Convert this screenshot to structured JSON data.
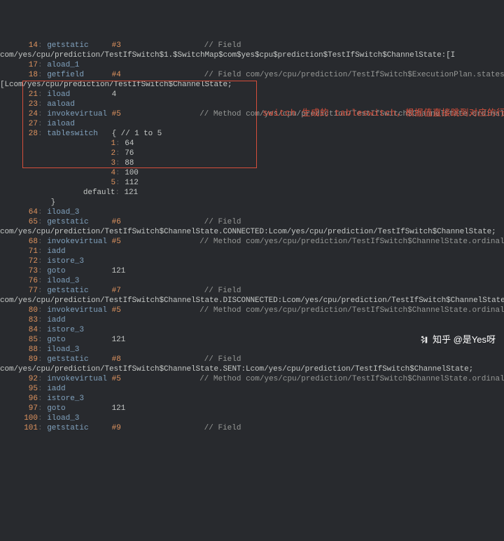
{
  "annotation": "switch 生成的 tableswitch，根据值直接跳到对应的行执行",
  "watermark": "知乎 @是Yes呀",
  "code": [
    {
      "ln": "14",
      "op": "getstatic",
      "arg": "#3",
      "comment": "// Field",
      "type": "a"
    },
    {
      "raw": "com/yes/cpu/prediction/TestIfSwitch$1.$SwitchMap$com$yes$cpu$prediction$TestIfSwitch$ChannelState:[I"
    },
    {
      "ln": "17",
      "op": "aload_1",
      "type": "b"
    },
    {
      "ln": "18",
      "op": "getfield",
      "arg": "#4",
      "comment": "// Field com/yes/cpu/prediction/TestIfSwitch$ExecutionPlan.states:",
      "type": "a"
    },
    {
      "raw": "[Lcom/yes/cpu/prediction/TestIfSwitch$ChannelState;"
    },
    {
      "ln": "21",
      "op": "iload",
      "argn": "4",
      "type": "c"
    },
    {
      "ln": "23",
      "op": "aaload",
      "type": "b"
    },
    {
      "ln": "24",
      "op": "invokevirtual",
      "arg2": "#5",
      "comment": "// Method com/yes/cpu/prediction/TestIfSwitch$ChannelState.ordinal:()I",
      "type": "d"
    },
    {
      "ln": "27",
      "op": "iaload",
      "type": "b"
    },
    {
      "ln": "28",
      "op": "tableswitch",
      "tail": "{ // 1 to 5",
      "type": "e"
    },
    {
      "sw": "1",
      "sv": "64"
    },
    {
      "sw": "2",
      "sv": "76"
    },
    {
      "sw": "3",
      "sv": "88"
    },
    {
      "sw": "4",
      "sv": "100"
    },
    {
      "sw": "5",
      "sv": "112"
    },
    {
      "swd": "default",
      "sv": "121"
    },
    {
      "braceclose": "}"
    },
    {
      "ln": "64",
      "op": "iload_3",
      "type": "b"
    },
    {
      "ln": "65",
      "op": "getstatic",
      "arg": "#6",
      "comment": "// Field",
      "type": "a"
    },
    {
      "raw": "com/yes/cpu/prediction/TestIfSwitch$ChannelState.CONNECTED:Lcom/yes/cpu/prediction/TestIfSwitch$ChannelState;"
    },
    {
      "ln": "68",
      "op": "invokevirtual",
      "arg2": "#5",
      "comment": "// Method com/yes/cpu/prediction/TestIfSwitch$ChannelState.ordinal:()I",
      "type": "d"
    },
    {
      "ln": "71",
      "op": "iadd",
      "type": "b"
    },
    {
      "ln": "72",
      "op": "istore_3",
      "type": "b"
    },
    {
      "ln": "73",
      "op": "goto",
      "argn": "121",
      "type": "c"
    },
    {
      "ln": "76",
      "op": "iload_3",
      "type": "b"
    },
    {
      "ln": "77",
      "op": "getstatic",
      "arg": "#7",
      "comment": "// Field",
      "type": "a"
    },
    {
      "raw": "com/yes/cpu/prediction/TestIfSwitch$ChannelState.DISCONNECTED:Lcom/yes/cpu/prediction/TestIfSwitch$ChannelState;"
    },
    {
      "ln": "80",
      "op": "invokevirtual",
      "arg2": "#5",
      "comment": "// Method com/yes/cpu/prediction/TestIfSwitch$ChannelState.ordinal:()I",
      "type": "d"
    },
    {
      "ln": "83",
      "op": "iadd",
      "type": "b"
    },
    {
      "ln": "84",
      "op": "istore_3",
      "type": "b"
    },
    {
      "ln": "85",
      "op": "goto",
      "argn": "121",
      "type": "c"
    },
    {
      "ln": "88",
      "op": "iload_3",
      "type": "b"
    },
    {
      "ln": "89",
      "op": "getstatic",
      "arg": "#8",
      "comment": "// Field",
      "type": "a"
    },
    {
      "raw": "com/yes/cpu/prediction/TestIfSwitch$ChannelState.SENT:Lcom/yes/cpu/prediction/TestIfSwitch$ChannelState;"
    },
    {
      "ln": "92",
      "op": "invokevirtual",
      "arg2": "#5",
      "comment": "// Method com/yes/cpu/prediction/TestIfSwitch$ChannelState.ordinal:()I",
      "type": "d"
    },
    {
      "ln": "95",
      "op": "iadd",
      "type": "b"
    },
    {
      "ln": "96",
      "op": "istore_3",
      "type": "b"
    },
    {
      "ln": "97",
      "op": "goto",
      "argn": "121",
      "type": "c"
    },
    {
      "ln": "100",
      "op": "iload_3",
      "type": "b"
    },
    {
      "ln": "101",
      "op": "getstatic",
      "arg": "#9",
      "comment": "// Field",
      "type": "a"
    }
  ]
}
